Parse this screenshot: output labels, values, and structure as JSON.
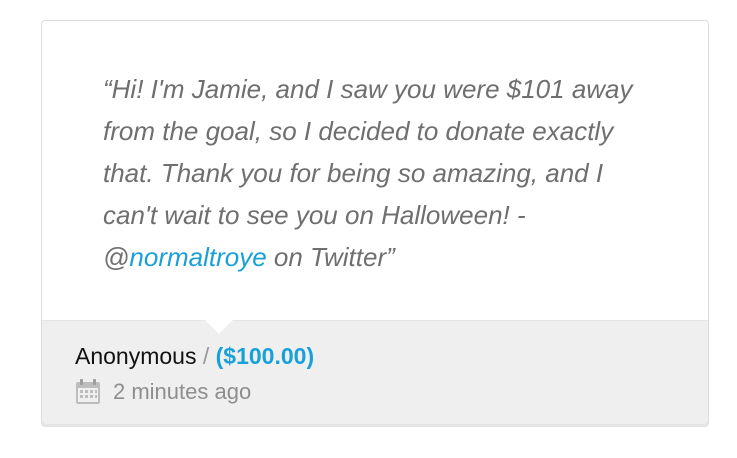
{
  "donation": {
    "message_before": "“Hi! I'm Jamie, and I saw you were $101 away from the goal, so I decided to donate exactly that. Thank you for being so amazing, and I can't wait to see you on Halloween! - ",
    "handle_prefix": "@",
    "handle": "normaltroye",
    "message_after": " on Twitter”",
    "donor": "Anonymous",
    "separator": "/",
    "amount": "($100.00)",
    "time_ago": "2 minutes ago"
  },
  "icons": {
    "calendar": "calendar-icon"
  },
  "colors": {
    "link_accent": "#1aa0d8",
    "message_text": "#6f6f6f",
    "footer_bg": "#efefef"
  }
}
